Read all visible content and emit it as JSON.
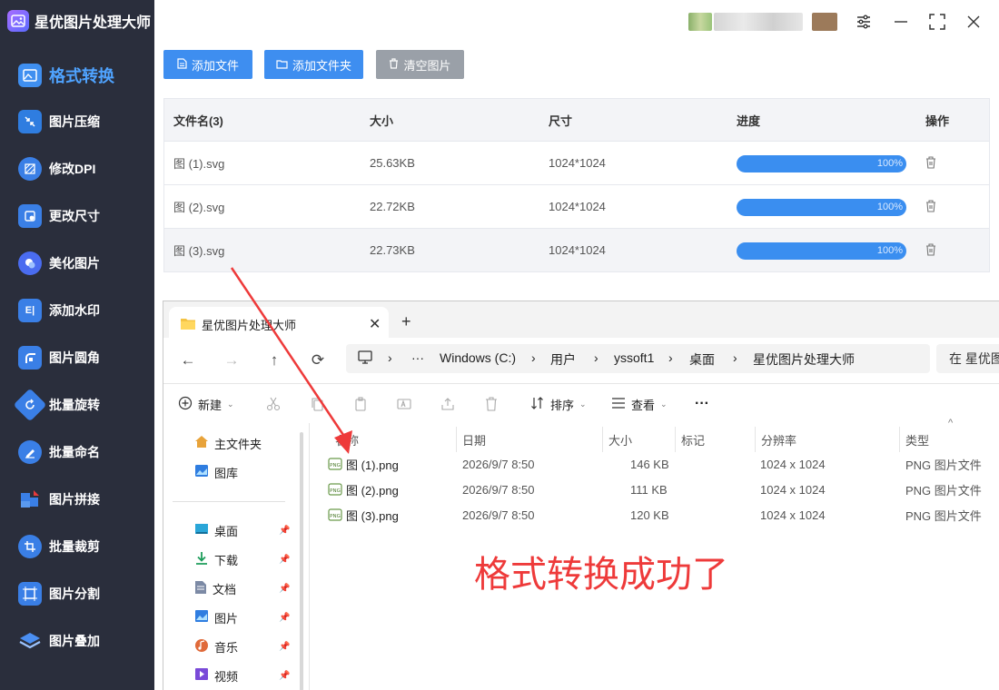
{
  "app": {
    "title": "星优图片处理大师"
  },
  "sidebar": {
    "items": [
      {
        "label": "格式转换",
        "active": true,
        "icon": "image-swap-icon"
      },
      {
        "label": "图片压缩",
        "icon": "compress-icon"
      },
      {
        "label": "修改DPI",
        "icon": "dpi-icon"
      },
      {
        "label": "更改尺寸",
        "icon": "resize-icon"
      },
      {
        "label": "美化图片",
        "icon": "beautify-icon"
      },
      {
        "label": "添加水印",
        "icon": "watermark-icon"
      },
      {
        "label": "图片圆角",
        "icon": "round-corner-icon"
      },
      {
        "label": "批量旋转",
        "icon": "rotate-icon"
      },
      {
        "label": "批量命名",
        "icon": "rename-icon"
      },
      {
        "label": "图片拼接",
        "icon": "stitch-icon"
      },
      {
        "label": "批量裁剪",
        "icon": "crop-icon"
      },
      {
        "label": "图片分割",
        "icon": "split-icon"
      },
      {
        "label": "图片叠加",
        "icon": "layers-icon"
      }
    ]
  },
  "toolbar": {
    "add_file": "添加文件",
    "add_folder": "添加文件夹",
    "clear": "清空图片"
  },
  "grid": {
    "headers": {
      "name": "文件名(3)",
      "size": "大小",
      "dims": "尺寸",
      "progress": "进度",
      "action": "操作"
    },
    "rows": [
      {
        "name": "图 (1).svg",
        "size": "25.63KB",
        "dims": "1024*1024",
        "progress_text": "100%",
        "progress": 1.0
      },
      {
        "name": "图 (2).svg",
        "size": "22.72KB",
        "dims": "1024*1024",
        "progress_text": "100%",
        "progress": 1.0
      },
      {
        "name": "图 (3).svg",
        "size": "22.73KB",
        "dims": "1024*1024",
        "progress_text": "100%",
        "progress": 1.0
      }
    ]
  },
  "explorer": {
    "tab_title": "星优图片处理大师",
    "path": [
      "Windows (C:)",
      "用户",
      "yssoft1",
      "桌面",
      "星优图片处理大师"
    ],
    "search_placeholder": "在 星优图",
    "commands": {
      "new": "新建",
      "sort": "排序",
      "view": "查看",
      "more": "···"
    },
    "nav_items": [
      {
        "label": "主文件夹",
        "icon": "home-icon"
      },
      {
        "label": "图库",
        "icon": "gallery-icon"
      },
      {
        "label": "桌面",
        "icon": "desktop-icon",
        "pinned": true
      },
      {
        "label": "下载",
        "icon": "download-icon",
        "pinned": true
      },
      {
        "label": "文档",
        "icon": "document-icon",
        "pinned": true
      },
      {
        "label": "图片",
        "icon": "pictures-icon",
        "pinned": true
      },
      {
        "label": "音乐",
        "icon": "music-icon",
        "pinned": true
      },
      {
        "label": "视频",
        "icon": "video-icon",
        "pinned": true
      }
    ],
    "columns": {
      "name": "名称",
      "date": "日期",
      "size": "大小",
      "tag": "标记",
      "res": "分辨率",
      "type": "类型"
    },
    "files": [
      {
        "name": "图 (1).png",
        "date": "2026/9/7 8:50",
        "size": "146 KB",
        "res": "1024 x 1024",
        "type": "PNG 图片文件"
      },
      {
        "name": "图 (2).png",
        "date": "2026/9/7 8:50",
        "size": "111 KB",
        "res": "1024 x 1024",
        "type": "PNG 图片文件"
      },
      {
        "name": "图 (3).png",
        "date": "2026/9/7 8:50",
        "size": "120 KB",
        "res": "1024 x 1024",
        "type": "PNG 图片文件"
      }
    ]
  },
  "overlay_message": "格式转换成功了",
  "colors": {
    "sidebar_bg": "#2a2e3c",
    "accent": "#4fa3ff",
    "button_blue": "#3e8ef0",
    "button_gray": "#9aa0a8",
    "progress": "#3a8ef0",
    "annotation_red": "#ee3a3a"
  }
}
